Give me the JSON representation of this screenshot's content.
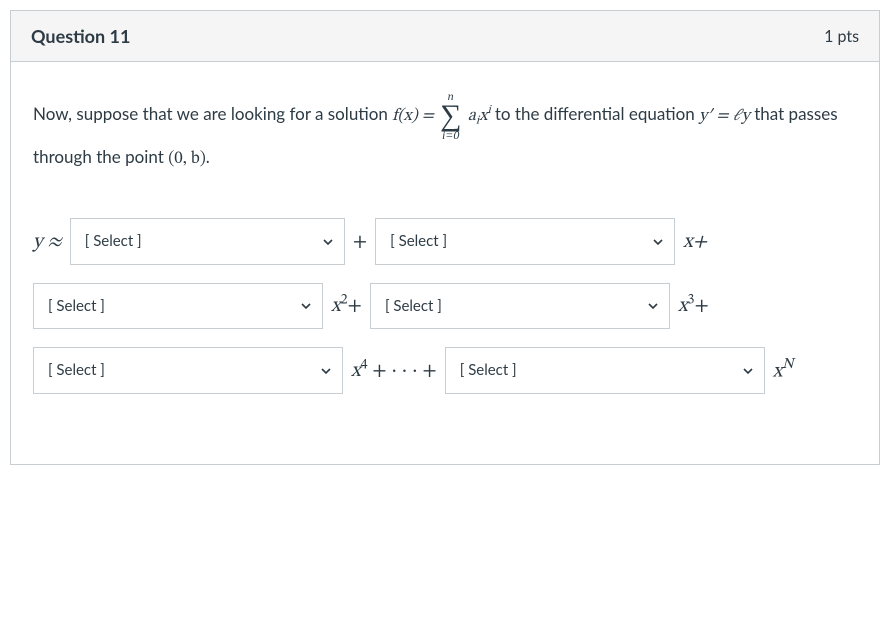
{
  "header": {
    "title": "Question 11",
    "points": "1 pts"
  },
  "prompt": {
    "t1": "Now, suppose that we are looking for a solution ",
    "fx": "f(x) = ",
    "sum_upper": "n",
    "sum_lower": "i=0",
    "sum_body_a": "a",
    "sum_body_sub": "i",
    "sum_body_x": "x",
    "sum_body_sup": "i",
    "t2": "  to the differential equation ",
    "eq_lhs": "y′ = ℓy",
    "t3": " that passes through the point ",
    "pt": "(0, b)",
    "t4": "."
  },
  "labels": {
    "y_approx": "y ≈",
    "plus": "+",
    "x_plus": "x+",
    "x2_plus_pre": "x",
    "x2_sup": "2",
    "x2_plus_post": "+",
    "x3_plus_pre": "x",
    "x3_sup": "3",
    "x3_plus_post": "+",
    "x4_plus_pre": "x",
    "x4_sup": "4",
    "x4_dots": " + · · · +",
    "xN_pre": "x",
    "xN_sup": "N"
  },
  "selects": {
    "placeholder": "[ Select ]"
  }
}
